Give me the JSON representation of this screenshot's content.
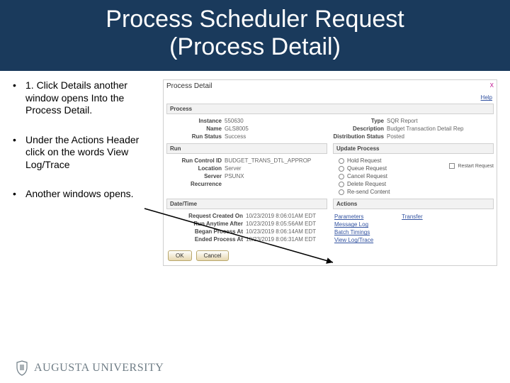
{
  "title": {
    "line1": "Process Scheduler Request",
    "line2": "(Process Detail)"
  },
  "bullets": [
    "1. Click Details another window opens Into the Process Detail.",
    "Under the Actions Header  click on the words View Log/Trace",
    "Another windows opens."
  ],
  "screenshot": {
    "window_title": "Process Detail",
    "close": "X",
    "help": "Help",
    "sections": {
      "process": {
        "header": "Process",
        "left": [
          {
            "lbl": "Instance",
            "val": "550630"
          },
          {
            "lbl": "Name",
            "val": "GLS8005"
          },
          {
            "lbl": "Run Status",
            "val": "Success"
          }
        ],
        "right": [
          {
            "lbl": "Type",
            "val": "SQR Report"
          },
          {
            "lbl": "Description",
            "val": "Budget Transaction Detail Rep"
          },
          {
            "lbl": "Distribution Status",
            "val": "Posted"
          }
        ]
      },
      "run": {
        "header": "Run",
        "rows": [
          {
            "lbl": "Run Control ID",
            "val": "BUDGET_TRANS_DTL_APPROP"
          },
          {
            "lbl": "Location",
            "val": "Server"
          },
          {
            "lbl": "Server",
            "val": "PSUNX"
          },
          {
            "lbl": "Recurrence",
            "val": ""
          }
        ]
      },
      "update": {
        "header": "Update Process",
        "options": [
          "Hold Request",
          "Queue Request",
          "Cancel Request",
          "Delete Request",
          "Re-send Content"
        ],
        "restart": "Restart Request"
      },
      "datetime": {
        "header": "Date/Time",
        "rows": [
          {
            "lbl": "Request Created On",
            "val": "10/23/2019  8:06:01AM EDT"
          },
          {
            "lbl": "Run Anytime After",
            "val": "10/23/2019  8:05:56AM EDT"
          },
          {
            "lbl": "Began Process At",
            "val": "10/23/2019  8:06:14AM EDT"
          },
          {
            "lbl": "Ended Process At",
            "val": "10/23/2019  8:06:31AM EDT"
          }
        ]
      },
      "actions": {
        "header": "Actions",
        "links_left": [
          "Parameters",
          "Message Log",
          "Batch Timings",
          "View Log/Trace"
        ],
        "links_right": [
          "Transfer"
        ]
      }
    },
    "buttons": {
      "ok": "OK",
      "cancel": "Cancel"
    }
  },
  "footer": {
    "brand": "AUGUSTA",
    "sub": "UNIVERSITY"
  },
  "colors": {
    "title_bg": "#1a3a5c",
    "link": "#3353a1",
    "logo": "#6f7d86"
  }
}
